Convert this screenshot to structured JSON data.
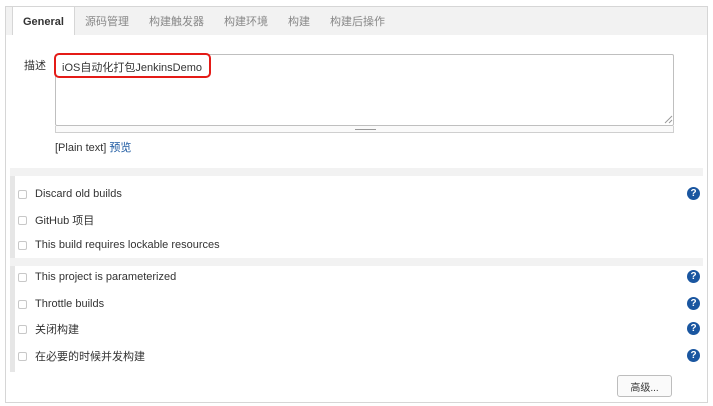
{
  "tabs": [
    {
      "label": "General",
      "active": true
    },
    {
      "label": "源码管理"
    },
    {
      "label": "构建触发器"
    },
    {
      "label": "构建环境"
    },
    {
      "label": "构建"
    },
    {
      "label": "构建后操作"
    }
  ],
  "description": {
    "label": "描述",
    "value": "iOS自动化打包JenkinsDemo",
    "format_text": "[Plain text]",
    "preview_link": "预览"
  },
  "options": [
    {
      "label": "Discard old builds",
      "help": true
    },
    {
      "label": "GitHub 项目",
      "help": false
    },
    {
      "label": "This build requires lockable resources",
      "help": false
    },
    {
      "label": "This project is parameterized",
      "help": true
    },
    {
      "label": "Throttle builds",
      "help": true
    },
    {
      "label": "关闭构建",
      "help": true
    },
    {
      "label": "在必要的时候并发构建",
      "help": true
    }
  ],
  "help_glyph": "?",
  "advanced_button": "高级...",
  "colors": {
    "highlight": "#e41b17",
    "link": "#1a57a0",
    "help": "#1a56a0"
  }
}
